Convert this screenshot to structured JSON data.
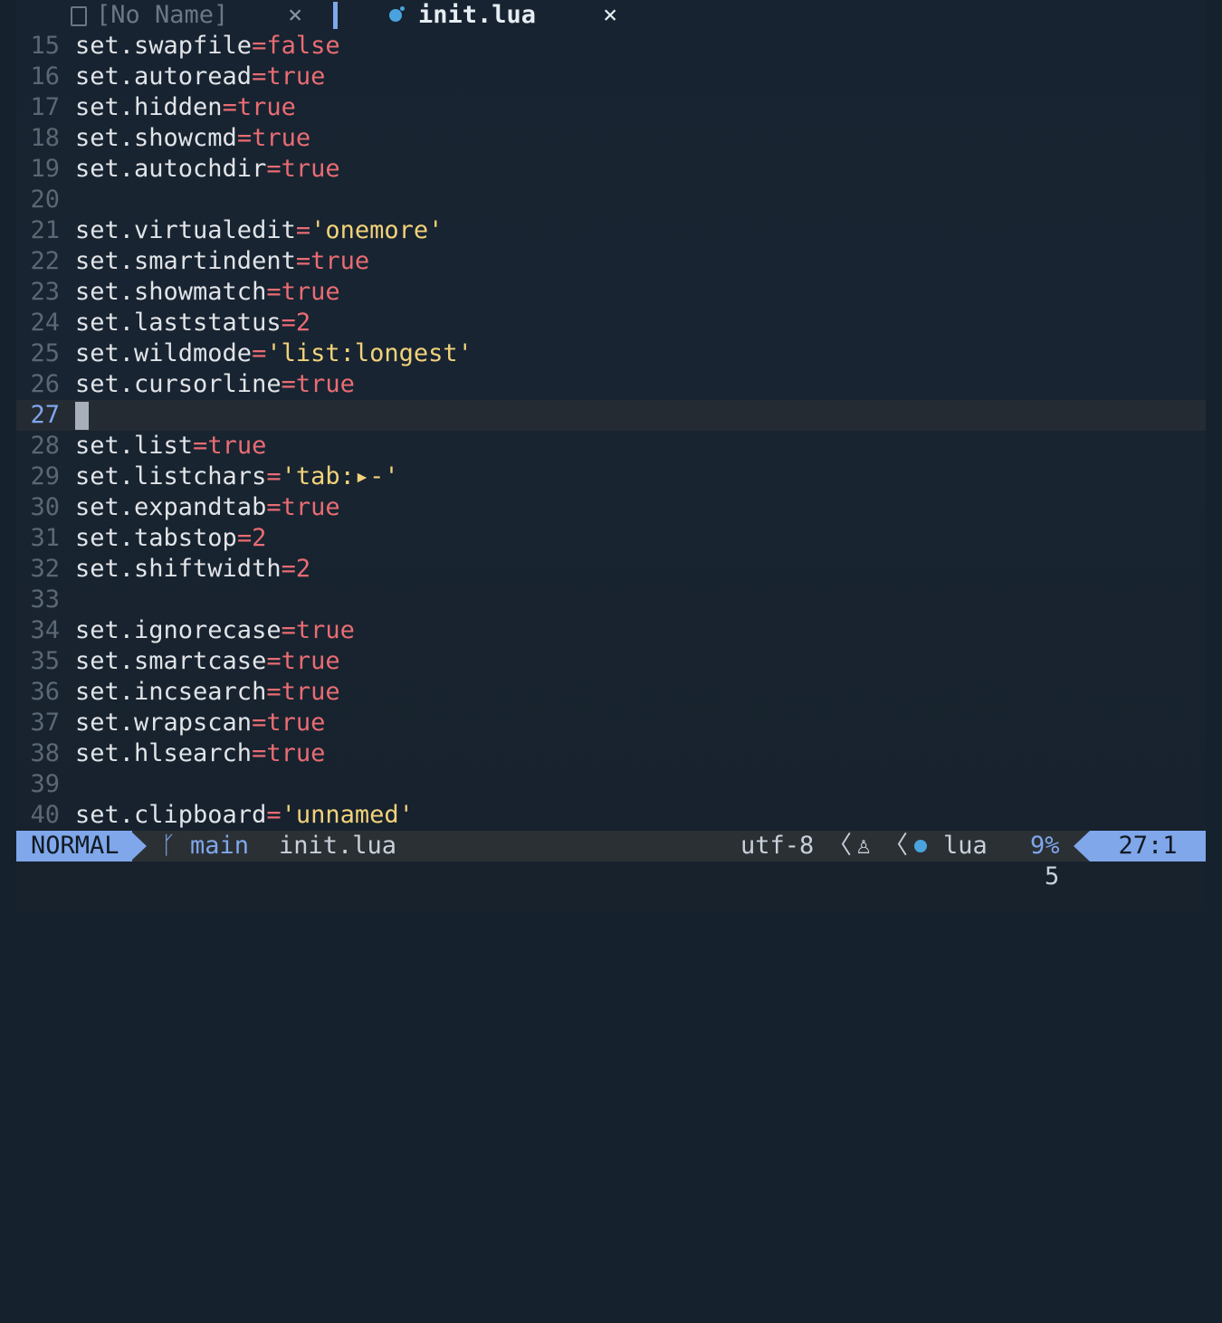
{
  "tabs": {
    "inactive": {
      "label": "[No Name]",
      "close": "×"
    },
    "active": {
      "label": "init.lua",
      "close": "×"
    }
  },
  "editor": {
    "current_line": "27",
    "lines": [
      {
        "n": "15",
        "segs": [
          {
            "t": "set.swapfile",
            "c": "id"
          },
          {
            "t": "=",
            "c": "op"
          },
          {
            "t": "false",
            "c": "op"
          }
        ]
      },
      {
        "n": "16",
        "segs": [
          {
            "t": "set.autoread",
            "c": "id"
          },
          {
            "t": "=",
            "c": "op"
          },
          {
            "t": "true",
            "c": "op"
          }
        ]
      },
      {
        "n": "17",
        "segs": [
          {
            "t": "set.hidden",
            "c": "id"
          },
          {
            "t": "=",
            "c": "op"
          },
          {
            "t": "true",
            "c": "op"
          }
        ]
      },
      {
        "n": "18",
        "segs": [
          {
            "t": "set.showcmd",
            "c": "id"
          },
          {
            "t": "=",
            "c": "op"
          },
          {
            "t": "true",
            "c": "op"
          }
        ]
      },
      {
        "n": "19",
        "segs": [
          {
            "t": "set.autochdir",
            "c": "id"
          },
          {
            "t": "=",
            "c": "op"
          },
          {
            "t": "true",
            "c": "op"
          }
        ]
      },
      {
        "n": "20",
        "segs": []
      },
      {
        "n": "21",
        "segs": [
          {
            "t": "set.virtualedit",
            "c": "id"
          },
          {
            "t": "=",
            "c": "op"
          },
          {
            "t": "'onemore'",
            "c": "str"
          }
        ]
      },
      {
        "n": "22",
        "segs": [
          {
            "t": "set.smartindent",
            "c": "id"
          },
          {
            "t": "=",
            "c": "op"
          },
          {
            "t": "true",
            "c": "op"
          }
        ]
      },
      {
        "n": "23",
        "segs": [
          {
            "t": "set.showmatch",
            "c": "id"
          },
          {
            "t": "=",
            "c": "op"
          },
          {
            "t": "true",
            "c": "op"
          }
        ]
      },
      {
        "n": "24",
        "segs": [
          {
            "t": "set.laststatus",
            "c": "id"
          },
          {
            "t": "=",
            "c": "op"
          },
          {
            "t": "2",
            "c": "op"
          }
        ]
      },
      {
        "n": "25",
        "segs": [
          {
            "t": "set.wildmode",
            "c": "id"
          },
          {
            "t": "=",
            "c": "op"
          },
          {
            "t": "'list:longest'",
            "c": "str"
          }
        ]
      },
      {
        "n": "26",
        "segs": [
          {
            "t": "set.cursorline",
            "c": "id"
          },
          {
            "t": "=",
            "c": "op"
          },
          {
            "t": "true",
            "c": "op"
          }
        ]
      },
      {
        "n": "27",
        "segs": [],
        "current": true
      },
      {
        "n": "28",
        "segs": [
          {
            "t": "set.list",
            "c": "id"
          },
          {
            "t": "=",
            "c": "op"
          },
          {
            "t": "true",
            "c": "op"
          }
        ]
      },
      {
        "n": "29",
        "segs": [
          {
            "t": "set.listchars",
            "c": "id"
          },
          {
            "t": "=",
            "c": "op"
          },
          {
            "t": "'tab:▸-'",
            "c": "str"
          }
        ]
      },
      {
        "n": "30",
        "segs": [
          {
            "t": "set.expandtab",
            "c": "id"
          },
          {
            "t": "=",
            "c": "op"
          },
          {
            "t": "true",
            "c": "op"
          }
        ]
      },
      {
        "n": "31",
        "segs": [
          {
            "t": "set.tabstop",
            "c": "id"
          },
          {
            "t": "=",
            "c": "op"
          },
          {
            "t": "2",
            "c": "op"
          }
        ]
      },
      {
        "n": "32",
        "segs": [
          {
            "t": "set.shiftwidth",
            "c": "id"
          },
          {
            "t": "=",
            "c": "op"
          },
          {
            "t": "2",
            "c": "op"
          }
        ]
      },
      {
        "n": "33",
        "segs": []
      },
      {
        "n": "34",
        "segs": [
          {
            "t": "set.ignorecase",
            "c": "id"
          },
          {
            "t": "=",
            "c": "op"
          },
          {
            "t": "true",
            "c": "op"
          }
        ]
      },
      {
        "n": "35",
        "segs": [
          {
            "t": "set.smartcase",
            "c": "id"
          },
          {
            "t": "=",
            "c": "op"
          },
          {
            "t": "true",
            "c": "op"
          }
        ]
      },
      {
        "n": "36",
        "segs": [
          {
            "t": "set.incsearch",
            "c": "id"
          },
          {
            "t": "=",
            "c": "op"
          },
          {
            "t": "true",
            "c": "op"
          }
        ]
      },
      {
        "n": "37",
        "segs": [
          {
            "t": "set.wrapscan",
            "c": "id"
          },
          {
            "t": "=",
            "c": "op"
          },
          {
            "t": "true",
            "c": "op"
          }
        ]
      },
      {
        "n": "38",
        "segs": [
          {
            "t": "set.hlsearch",
            "c": "id"
          },
          {
            "t": "=",
            "c": "op"
          },
          {
            "t": "true",
            "c": "op"
          }
        ]
      },
      {
        "n": "39",
        "segs": []
      },
      {
        "n": "40",
        "segs": [
          {
            "t": "set.clipboard",
            "c": "id"
          },
          {
            "t": "=",
            "c": "op"
          },
          {
            "t": "'unnamed'",
            "c": "str"
          }
        ]
      }
    ]
  },
  "statusline": {
    "mode": "NORMAL",
    "branch_icon": "ᚴ",
    "branch": "main",
    "file": "init.lua",
    "encoding": "utf-8",
    "separator": "〈",
    "os_icon": "♙",
    "filetype": "lua",
    "percent": "9%",
    "position": "27:1"
  },
  "cmdline": {
    "count": "5"
  },
  "colors": {
    "accent": "#7fa7ea",
    "operator": "#e96c73",
    "string": "#f2d27a",
    "background": "#172330"
  }
}
